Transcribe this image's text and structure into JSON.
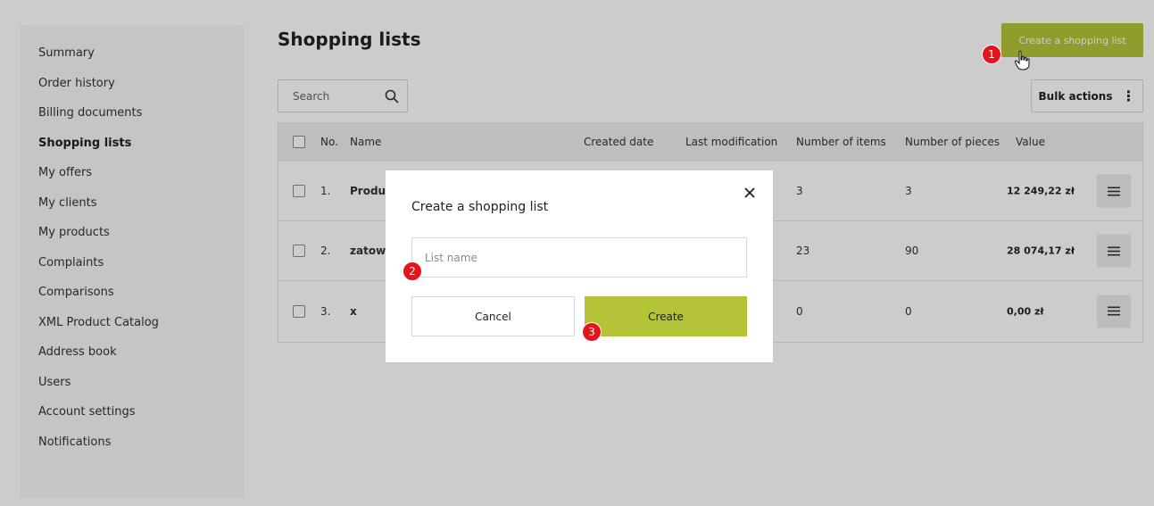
{
  "sidebar": {
    "items": [
      {
        "label": "Summary"
      },
      {
        "label": "Order history"
      },
      {
        "label": "Billing documents"
      },
      {
        "label": "Shopping lists"
      },
      {
        "label": "My offers"
      },
      {
        "label": "My clients"
      },
      {
        "label": "My products"
      },
      {
        "label": "Complaints"
      },
      {
        "label": "Comparisons"
      },
      {
        "label": "XML Product Catalog"
      },
      {
        "label": "Address book"
      },
      {
        "label": "Users"
      },
      {
        "label": "Account settings"
      },
      {
        "label": "Notifications"
      }
    ],
    "active": "Shopping lists"
  },
  "header": {
    "title": "Shopping lists",
    "create_button": "Create a shopping list"
  },
  "toolbar": {
    "search_placeholder": "Search",
    "bulk_actions_label": "Bulk actions"
  },
  "table": {
    "headers": {
      "no": "No.",
      "name": "Name",
      "created": "Created date",
      "modified": "Last modification",
      "items": "Number of items",
      "pieces": "Number of pieces",
      "value": "Value"
    },
    "rows": [
      {
        "no": "1.",
        "name": "Produk",
        "items": "3",
        "pieces": "3",
        "value": "12 249,22 zł"
      },
      {
        "no": "2.",
        "name": "zatowa",
        "items": "23",
        "pieces": "90",
        "value": "28 074,17 zł"
      },
      {
        "no": "3.",
        "name": "x",
        "items": "0",
        "pieces": "0",
        "value": "0,00 zł"
      }
    ]
  },
  "modal": {
    "title": "Create a shopping list",
    "input_placeholder": "List name",
    "cancel_label": "Cancel",
    "create_label": "Create"
  },
  "steps": [
    "1",
    "2",
    "3"
  ],
  "colors": {
    "accent": "#b5c436",
    "step_marker": "#e3141c"
  }
}
